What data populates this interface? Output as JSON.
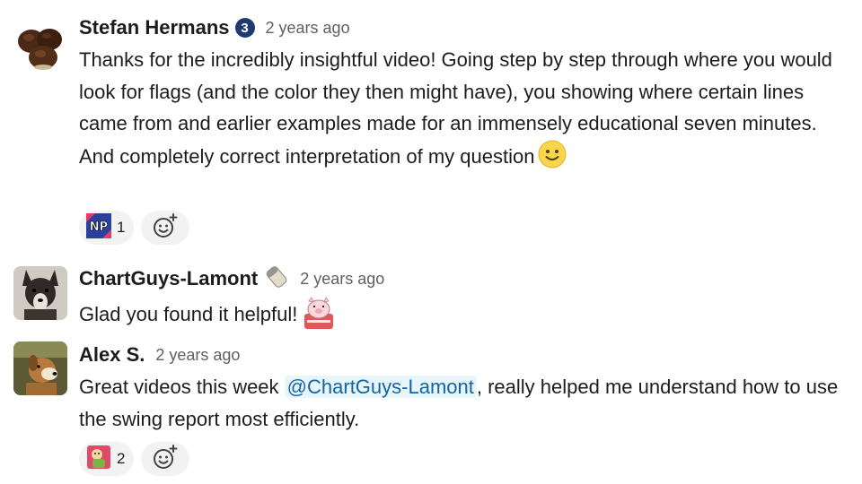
{
  "messages": [
    {
      "author": "Stefan Hermans",
      "badge": "3",
      "timestamp": "2 years ago",
      "text": "Thanks for the incredibly insightful video! Going step by step through where you would look for flags (and the color they then might have), you showing where certain lines came from and earlier examples made for an immensely educational seven minutes. And completely correct interpretation of my question",
      "reactions": [
        {
          "emoji": "np-custom-emoji",
          "count": "1"
        }
      ]
    },
    {
      "author": "ChartGuys-Lamont",
      "timestamp": "2 years ago",
      "text": "Glad you found it helpful!"
    },
    {
      "author": "Alex S.",
      "timestamp": "2 years ago",
      "text_before": "Great videos this week ",
      "mention": "@ChartGuys-Lamont",
      "text_after": ", really helped me understand how to use the swing report most efficiently.",
      "reactions": [
        {
          "emoji": "cartoon-character-emoji",
          "count": "2"
        }
      ]
    }
  ],
  "colors": {
    "text": "#1d1c1d",
    "muted": "#616061",
    "mention_bg": "#e8f5fa",
    "mention_text": "#1264a3",
    "reaction_bg": "#f2f2f2",
    "badge_bg": "#1d3b6e"
  }
}
